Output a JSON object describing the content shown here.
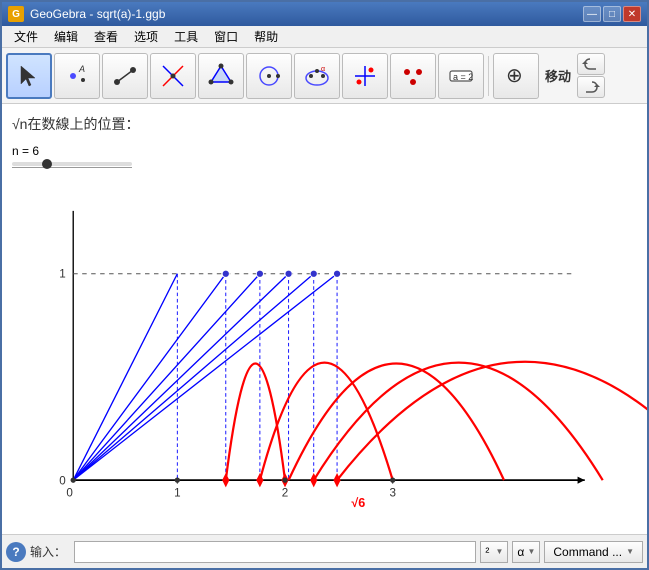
{
  "window": {
    "title": "GeoGebra - sqrt(a)-1.ggb",
    "icon": "G"
  },
  "menu": {
    "items": [
      "文件",
      "编辑",
      "查看",
      "选项",
      "工具",
      "窗口",
      "帮助"
    ]
  },
  "toolbar": {
    "tools": [
      {
        "name": "select",
        "label": "选择"
      },
      {
        "name": "point",
        "label": "点"
      },
      {
        "name": "line",
        "label": "线段"
      },
      {
        "name": "perpendicular",
        "label": "垂线"
      },
      {
        "name": "polygon",
        "label": "多边形"
      },
      {
        "name": "circle",
        "label": "圆"
      },
      {
        "name": "ellipse",
        "label": "椭圆"
      },
      {
        "name": "angle",
        "label": "角度"
      },
      {
        "name": "reflect",
        "label": "反射"
      },
      {
        "name": "input",
        "label": "输入框"
      },
      {
        "name": "move",
        "label": "移动"
      }
    ],
    "move_label": "移动"
  },
  "panel": {
    "title": "√n在数線上的位置：",
    "slider_label": "n = 6",
    "sqrt6_label": "√6"
  },
  "graph": {
    "x_axis_label": "0",
    "y_marks": [
      "0",
      "1"
    ],
    "x_marks": [
      "0",
      "1",
      "2",
      "3"
    ]
  },
  "status": {
    "help_label": "?",
    "input_label": "输入：",
    "input_placeholder": "",
    "superscript_btn": "²",
    "alpha_btn": "α",
    "command_btn": "Command ...",
    "dropdown_arrow": "▼"
  },
  "window_controls": {
    "minimize": "—",
    "maximize": "□",
    "close": "✕"
  }
}
